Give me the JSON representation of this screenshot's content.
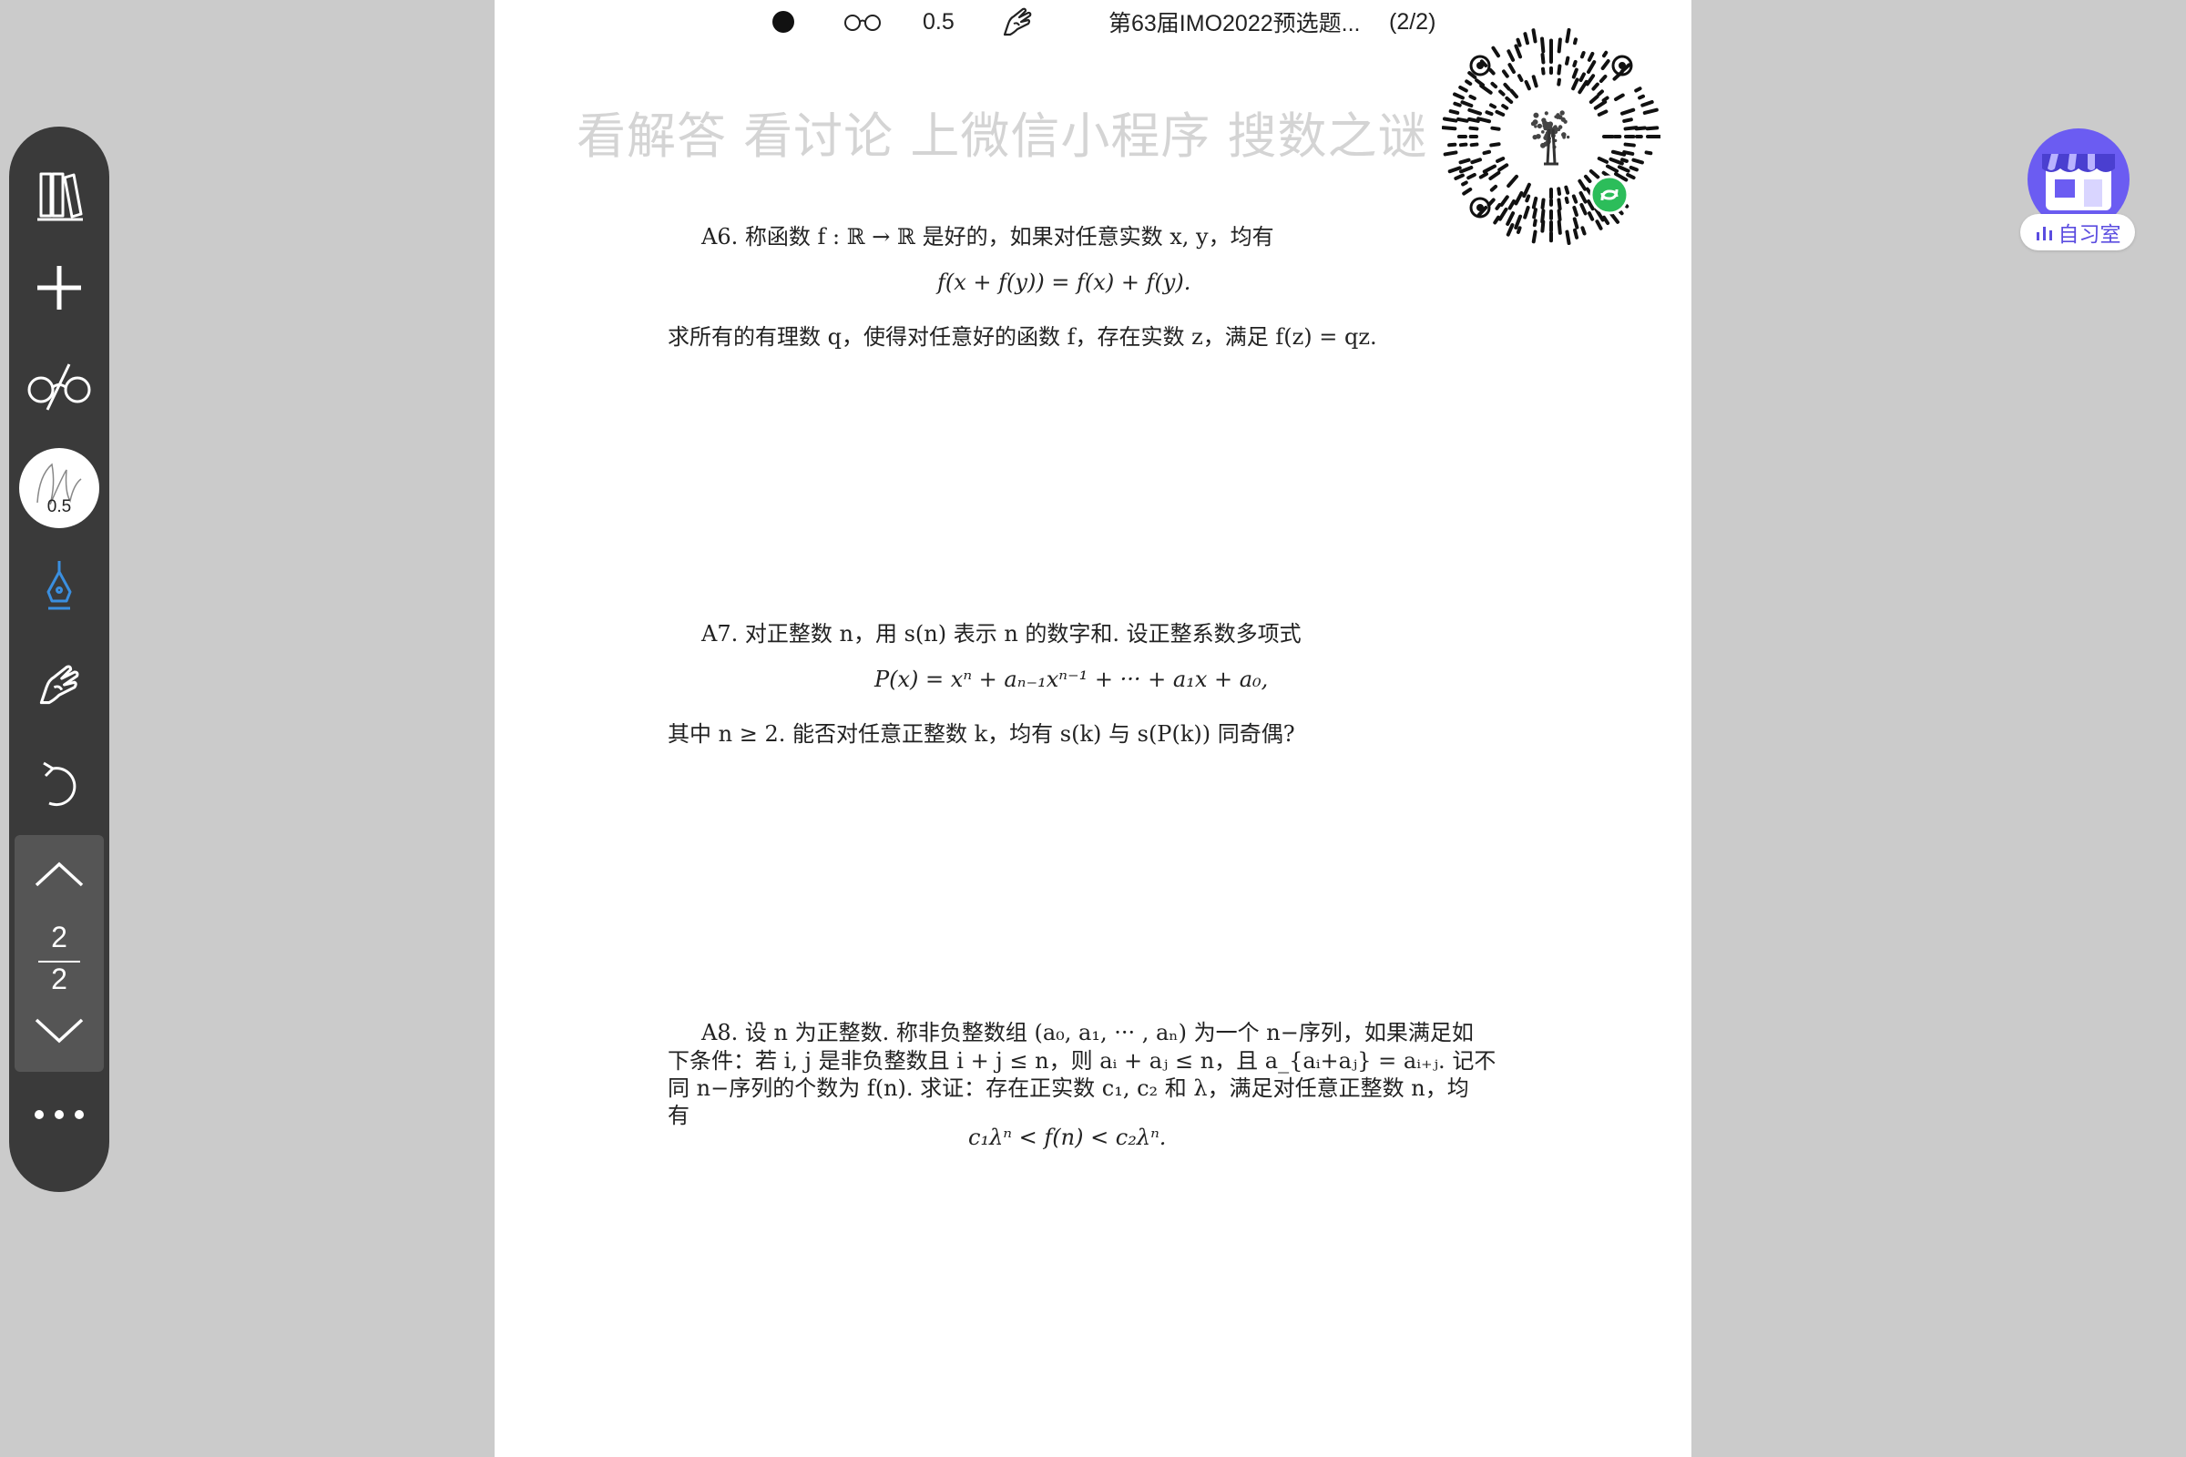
{
  "toolbar": {
    "pen_width": "0.5",
    "document_title": "第63届IMO2022预选题...",
    "page_indicator": "(2/2)"
  },
  "watermark": "看解答 看讨论 上微信小程序 搜数之谜",
  "problems": {
    "a6": {
      "line1": "A6. 称函数 f : ℝ → ℝ 是好的，如果对任意实数 x, y，均有",
      "formula": "f(x + f(y)) = f(x) + f(y).",
      "line2": "求所有的有理数 q，使得对任意好的函数 f，存在实数 z，满足 f(z) = qz."
    },
    "a7": {
      "line1": "A7. 对正整数 n，用 s(n) 表示 n 的数字和. 设正整系数多项式",
      "formula": "P(x) = xⁿ + aₙ₋₁xⁿ⁻¹ + ··· + a₁x + a₀,",
      "line2": "其中 n ≥ 2. 能否对任意正整数 k，均有 s(k) 与 s(P(k)) 同奇偶?"
    },
    "a8": {
      "line1": "A8. 设 n 为正整数. 称非负整数组 (a₀, a₁, ··· , aₙ) 为一个 n−序列，如果满足如",
      "line2": "下条件：若 i, j 是非负整数且 i + j ≤ n，则 aᵢ + aⱼ ≤ n，且 a_{aᵢ+aⱼ} = aᵢ₊ⱼ. 记不",
      "line3": "同 n−序列的个数为 f(n). 求证：存在正实数 c₁, c₂ 和 λ，满足对任意正整数 n，均",
      "line4": "有",
      "formula": "c₁λⁿ < f(n) < c₂λⁿ."
    }
  },
  "sidebar": {
    "pen_width": "0.5",
    "current_page": "2",
    "total_pages": "2"
  },
  "right_widget": {
    "label": "自习室",
    "accent": "#5b4de0"
  },
  "colors": {
    "background": "#cbcbcb",
    "sidebar": "#3a3a3a",
    "pen_active": "#3a8fe0",
    "qr_badge": "#2cbd5a"
  }
}
